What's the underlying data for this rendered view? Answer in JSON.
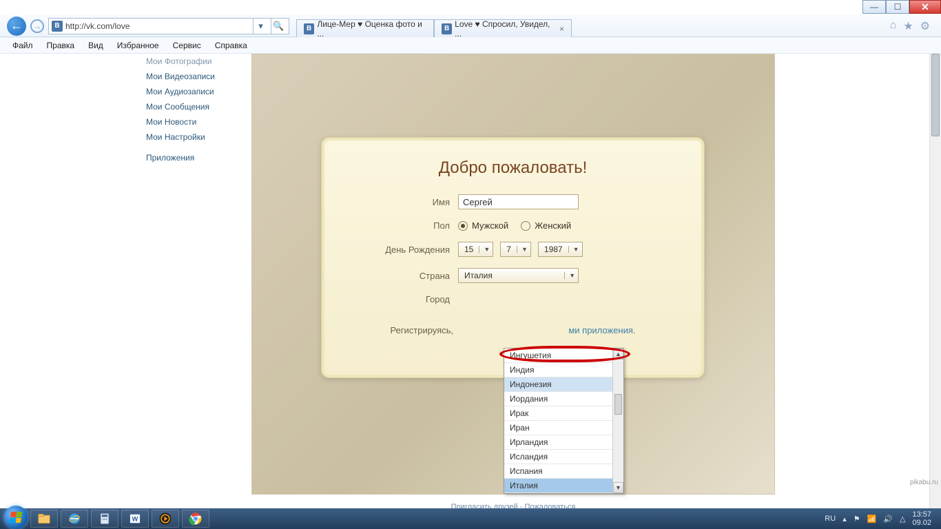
{
  "window_controls": {
    "minimize": "—",
    "maximize": "☐",
    "close": "✕"
  },
  "browser": {
    "url": "http://vk.com/love",
    "tabs": [
      {
        "label": "Лице-Мер ♥ Оценка фото и ..."
      },
      {
        "label": "Love ♥ Спросил, Увидел, ...",
        "active": true
      }
    ],
    "menu": [
      "Файл",
      "Правка",
      "Вид",
      "Избранное",
      "Сервис",
      "Справка"
    ]
  },
  "sidebar": {
    "items": [
      "Мои Фотографии",
      "Мои Видеозаписи",
      "Мои Аудиозаписи",
      "Мои Сообщения",
      "Мои Новости",
      "Мои Настройки"
    ],
    "extra": "Приложения"
  },
  "welcome": {
    "title": "Добро пожаловать!",
    "name_label": "Имя",
    "name_value": "Сергей",
    "gender_label": "Пол",
    "gender_male": "Мужской",
    "gender_female": "Женский",
    "gender_selected": "male",
    "dob_label": "День Рождения",
    "dob_day": "15",
    "dob_month": "7",
    "dob_year": "1987",
    "country_label": "Страна",
    "country_value": "Италия",
    "city_label": "Город",
    "terms_prefix": "Регистрируясь,",
    "terms_link": "ми приложения",
    "terms_dot": "."
  },
  "dropdown": {
    "options": [
      "Ингушетия",
      "Индия",
      "Индонезия",
      "Иордания",
      "Ирак",
      "Иран",
      "Ирландия",
      "Исландия",
      "Испания",
      "Италия"
    ],
    "highlighted": "Ингушетия",
    "hovered": "Индонезия",
    "selected": "Италия"
  },
  "footer": {
    "invite": "Пригласить друзей",
    "sep": " - ",
    "complain": "Пожаловаться"
  },
  "taskbar": {
    "lang": "RU",
    "time": "13:57",
    "date": "09.02"
  },
  "watermark": "pikabu.ru"
}
